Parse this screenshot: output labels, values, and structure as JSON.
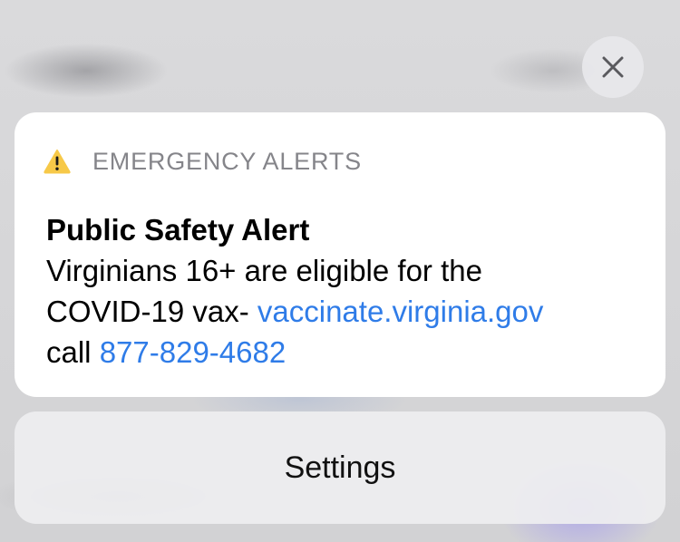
{
  "notification": {
    "app_name": "EMERGENCY ALERTS",
    "title": "Public Safety Alert",
    "body_line1": "Virginians 16+ are eligible for the",
    "body_line2_text": "COVID-19 vax- ",
    "website_link": "vaccinate.virginia.gov",
    "body_line3_text": "call ",
    "phone_link": "877-829-4682",
    "icon": "warning-triangle-icon",
    "colors": {
      "link": "#2f7ce8",
      "warning_fill": "#f7c948",
      "app_name": "#85858a"
    }
  },
  "close_button": {
    "icon": "close-icon"
  },
  "settings_button": {
    "label": "Settings"
  }
}
